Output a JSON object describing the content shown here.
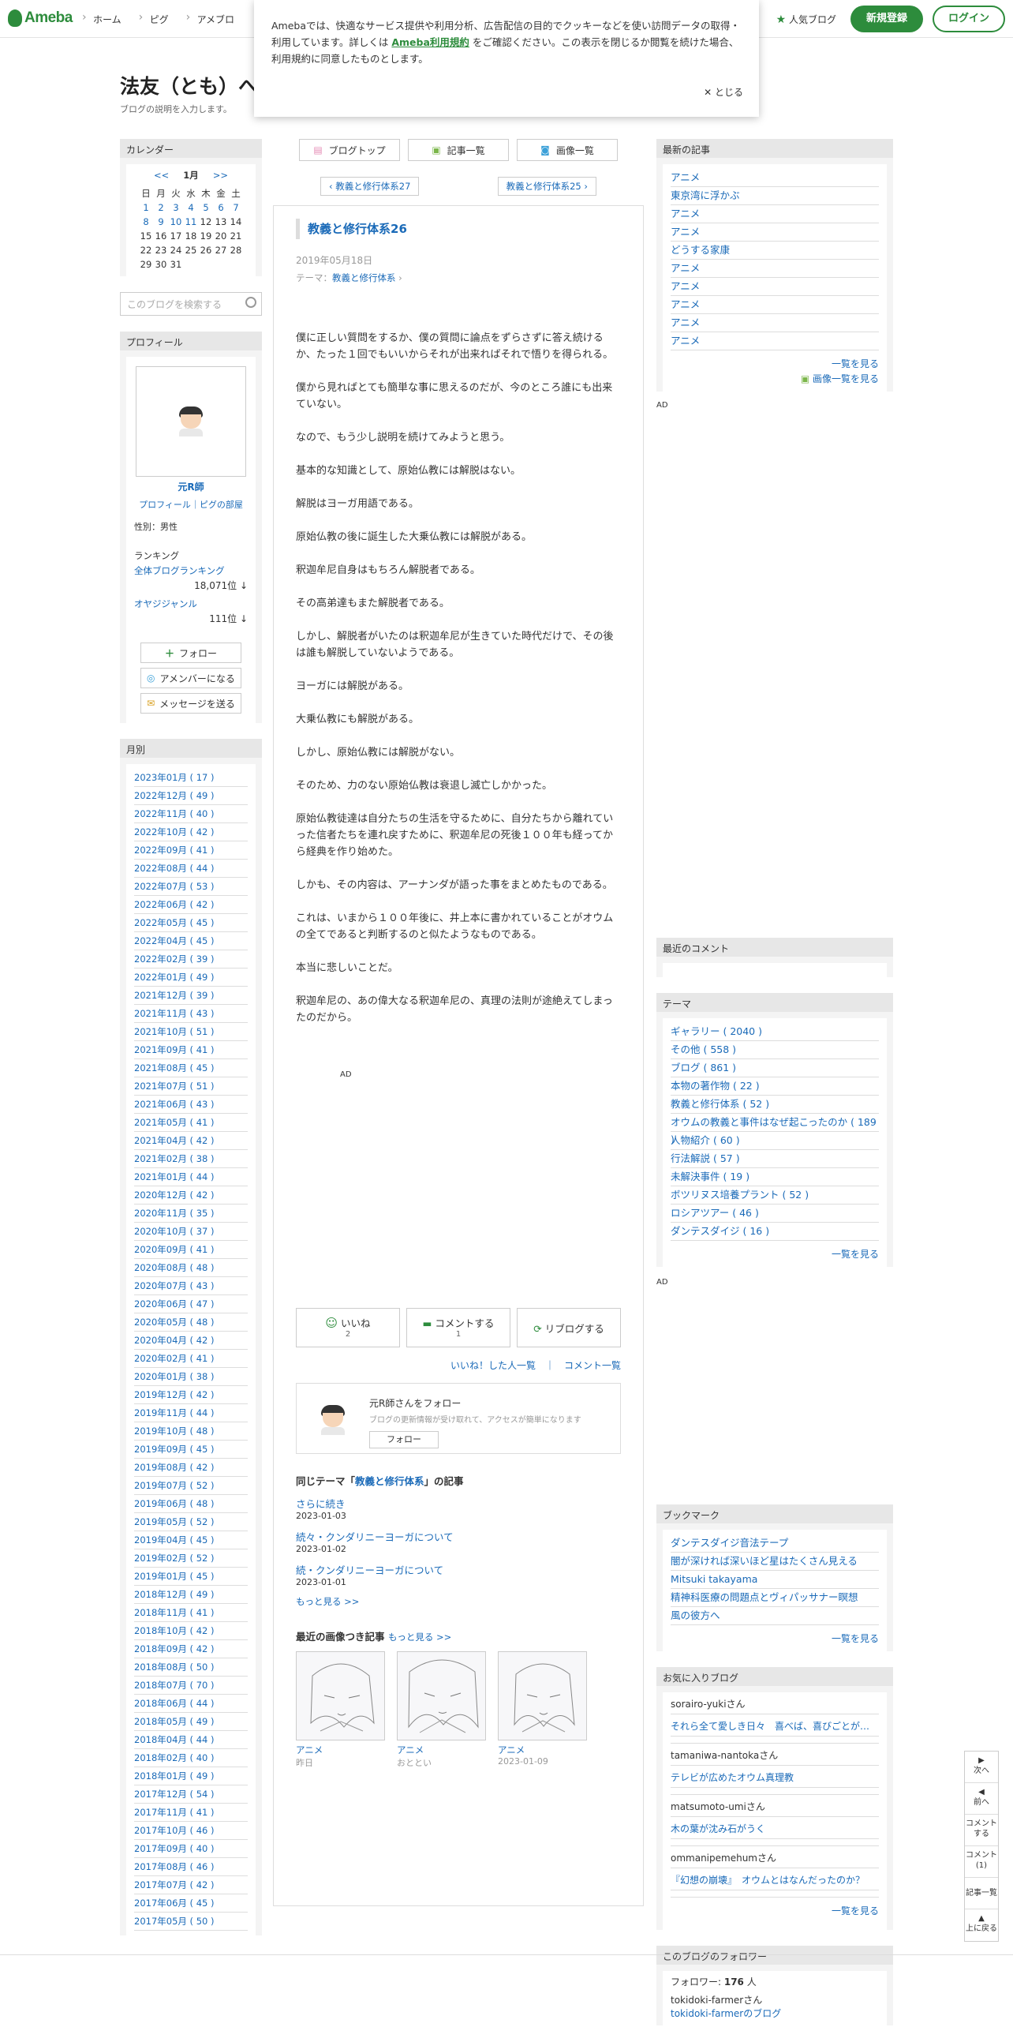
{
  "header": {
    "logo_text": "Ameba",
    "nav": [
      "ホーム",
      "ピグ",
      "アメブロ"
    ],
    "popular_blog": "人気ブログ",
    "register_label": "新規登録",
    "login_label": "ログイン"
  },
  "cookie": {
    "text1": "Amebaでは、快適なサービス提供や利用分析、広告配信の目的でクッキーなどを使い訪問データの取得・利用しています。詳しくは ",
    "link": "Ameba利用規約",
    "text2": " をご確認ください。この表示を閉じるか閲覧を続けた場合、利用規約に同意したものとします。",
    "close": "とじる"
  },
  "blog": {
    "title": "法友（とも）へ",
    "description": "ブログの説明を入力します。"
  },
  "calendar": {
    "heading": "カレンダー",
    "prev": "<<",
    "month": "1月",
    "next": ">>",
    "weekdays": [
      "日",
      "月",
      "火",
      "水",
      "木",
      "金",
      "土"
    ],
    "rows": [
      [
        "",
        "",
        "",
        "",
        "",
        "",
        ""
      ],
      [
        "1",
        "2",
        "3",
        "4",
        "5",
        "6",
        "7"
      ],
      [
        "8",
        "9",
        "10",
        "11",
        "12",
        "13",
        "14"
      ],
      [
        "15",
        "16",
        "17",
        "18",
        "19",
        "20",
        "21"
      ],
      [
        "22",
        "23",
        "24",
        "25",
        "26",
        "27",
        "28"
      ],
      [
        "29",
        "30",
        "31",
        "",
        "",
        "",
        ""
      ]
    ]
  },
  "search": {
    "placeholder": "このブログを検索する"
  },
  "profile": {
    "heading": "プロフィール",
    "name": "元R師",
    "links": "プロフィール｜ピグの部屋",
    "gender": "性別：男性",
    "ranking_label": "ランキング",
    "overall_label": "全体ブログランキング",
    "overall_value": "18,071位 ↓",
    "genre_label": "オヤジジャンル",
    "genre_value": "111位 ↓",
    "follow_btn": "フォロー",
    "member_btn": "アメンバーになる",
    "message_btn": "メッセージを送る"
  },
  "monthly": {
    "heading": "月別",
    "items": [
      "2023年01月 ( 17 )",
      "2022年12月 ( 49 )",
      "2022年11月 ( 40 )",
      "2022年10月 ( 42 )",
      "2022年09月 ( 41 )",
      "2022年08月 ( 44 )",
      "2022年07月 ( 53 )",
      "2022年06月 ( 42 )",
      "2022年05月 ( 45 )",
      "2022年04月 ( 45 )",
      "2022年02月 ( 39 )",
      "2022年01月 ( 49 )",
      "2021年12月 ( 39 )",
      "2021年11月 ( 43 )",
      "2021年10月 ( 51 )",
      "2021年09月 ( 41 )",
      "2021年08月 ( 45 )",
      "2021年07月 ( 51 )",
      "2021年06月 ( 43 )",
      "2021年05月 ( 41 )",
      "2021年04月 ( 42 )",
      "2021年02月 ( 38 )",
      "2021年01月 ( 44 )",
      "2020年12月 ( 42 )",
      "2020年11月 ( 35 )",
      "2020年10月 ( 37 )",
      "2020年09月 ( 41 )",
      "2020年08月 ( 48 )",
      "2020年07月 ( 43 )",
      "2020年06月 ( 47 )",
      "2020年05月 ( 48 )",
      "2020年04月 ( 42 )",
      "2020年02月 ( 41 )",
      "2020年01月 ( 38 )",
      "2019年12月 ( 42 )",
      "2019年11月 ( 44 )",
      "2019年10月 ( 48 )",
      "2019年09月 ( 45 )",
      "2019年08月 ( 42 )",
      "2019年07月 ( 52 )",
      "2019年06月 ( 48 )",
      "2019年05月 ( 52 )",
      "2019年04月 ( 45 )",
      "2019年02月 ( 52 )",
      "2019年01月 ( 45 )",
      "2018年12月 ( 49 )",
      "2018年11月 ( 41 )",
      "2018年10月 ( 42 )",
      "2018年09月 ( 42 )",
      "2018年08月 ( 50 )",
      "2018年07月 ( 70 )",
      "2018年06月 ( 44 )",
      "2018年05月 ( 49 )",
      "2018年04月 ( 44 )",
      "2018年02月 ( 40 )",
      "2018年01月 ( 49 )",
      "2017年12月 ( 54 )",
      "2017年11月 ( 41 )",
      "2017年10月 ( 46 )",
      "2017年09月 ( 40 )",
      "2017年08月 ( 46 )",
      "2017年07月 ( 42 )",
      "2017年06月 ( 45 )",
      "2017年05月 ( 50 )"
    ]
  },
  "topnav": {
    "top": "ブログトップ",
    "list": "記事一覧",
    "images": "画像一覧"
  },
  "pager": {
    "prev": "教義と修行体系27",
    "next": "教義と修行体系25"
  },
  "article": {
    "title": "教義と修行体系26",
    "date": "2019年05月18日",
    "theme_label": "テーマ：",
    "theme": "教義と修行体系",
    "paragraphs": [
      "僕に正しい質問をするか、僕の質問に論点をずらさずに答え続けるか、たった１回でもいいからそれが出来ればそれで悟りを得られる。",
      "僕から見ればとても簡単な事に思えるのだが、今のところ誰にも出来ていない。",
      "なので、もう少し説明を続けてみようと思う。",
      "基本的な知識として、原始仏教には解脱はない。",
      "解脱はヨーガ用語である。",
      "原始仏教の後に誕生した大乗仏教には解脱がある。",
      "釈迦牟尼自身はもちろん解脱者である。",
      "その高弟達もまた解脱者である。",
      "しかし、解脱者がいたのは釈迦牟尼が生きていた時代だけで、その後は誰も解脱していないようである。",
      "ヨーガには解脱がある。",
      "大乗仏教にも解脱がある。",
      "しかし、原始仏教には解脱がない。",
      "そのため、力のない原始仏教は衰退し滅亡しかかった。",
      "原始仏教徒達は自分たちの生活を守るために、自分たちから離れていった信者たちを連れ戻すために、釈迦牟尼の死後１００年も経ってから経典を作り始めた。",
      "しかも、その内容は、アーナンダが語った事をまとめたものである。",
      "これは、いまから１００年後に、井上本に書かれていることがオウムの全てであると判断するのと似たようなものである。",
      "本当に悲しいことだ。",
      "釈迦牟尼の、あの偉大なる釈迦牟尼の、真理の法則が途絶えてしまったのだから。"
    ],
    "ad": "AD",
    "like_label": "いいね",
    "like_count": "2",
    "comment_label": "コメントする",
    "comment_count": "1",
    "reblog_label": "リブログする",
    "liked_users": "いいね！した人一覧",
    "comment_list": "コメント一覧",
    "follow_name": "元R師さんをフォロー",
    "follow_desc": "ブログの更新情報が受け取れて、アクセスが簡単になります",
    "follow_btn": "フォロー",
    "same_theme_pre": "同じテーマ「",
    "same_theme_name": "教義と修行体系",
    "same_theme_post": "」の記事",
    "same_items": [
      {
        "title": "さらに続き",
        "date": "2023-01-03"
      },
      {
        "title": "続々・クンダリニーヨーガについて",
        "date": "2023-01-02"
      },
      {
        "title": "続・クンダリニーヨーガについて",
        "date": "2023-01-01"
      }
    ],
    "more": "もっと見る >>",
    "images_title": "最近の画像つき記事",
    "images_more": "もっと見る >>",
    "thumbs": [
      {
        "caption": "アニメ",
        "date": "昨日"
      },
      {
        "caption": "アニメ",
        "date": "おととい"
      },
      {
        "caption": "アニメ",
        "date": "2023-01-09"
      }
    ]
  },
  "recent": {
    "heading": "最新の記事",
    "items": [
      "アニメ",
      "東京湾に浮かぶ",
      "アニメ",
      "アニメ",
      "どうする家康",
      "アニメ",
      "アニメ",
      "アニメ",
      "アニメ",
      "アニメ"
    ],
    "more": "一覧を見る",
    "images_more": "画像一覧を見る"
  },
  "side_ad": "AD",
  "recent_comments": {
    "heading": "最近のコメント"
  },
  "themes": {
    "heading": "テーマ",
    "items": [
      "ギャラリー ( 2040 )",
      "その他 ( 558 )",
      "ブログ ( 861 )",
      "本物の著作物 ( 22 )",
      "教義と修行体系 ( 52 )",
      "オウムの教義と事件はなぜ起こったのか ( 189 )",
      "人物紹介 ( 60 )",
      "行法解説 ( 57 )",
      "未解決事件 ( 19 )",
      "ボツリヌス培養プラント ( 52 )",
      "ロシアツアー ( 46 )",
      "ダンテスダイジ ( 16 )"
    ],
    "more": "一覧を見る"
  },
  "bookmarks": {
    "heading": "ブックマーク",
    "items": [
      "ダンテスダイジ音法テープ",
      "闇が深ければ深いほど星はたくさん見える",
      "Mitsuki takayama",
      "精神科医療の問題点とヴィパッサナー瞑想",
      "風の彼方へ"
    ],
    "more": "一覧を見る"
  },
  "fav_reblog": {
    "heading": "お気に入りブログ",
    "items": [
      {
        "name": "sorairo-yukiさん",
        "title": "それら全て愛しき日々　喜べば、喜びごとが…"
      },
      {
        "name": "tamaniwa-nantokaさん",
        "title": "テレビが広めたオウム真理教"
      },
      {
        "name": "matsumoto-umiさん",
        "title": "木の葉が沈み石がうく"
      },
      {
        "name": "ommanipemehumさん",
        "title": "『幻想の崩壊』　オウムとはなんだったのか？"
      }
    ],
    "more": "一覧を見る"
  },
  "followers": {
    "heading": "このブログのフォロワー",
    "count_label": "フォロワー: ",
    "count": "176",
    "count_unit": " 人",
    "user": "tokidoki-farmerさん",
    "user_blog": "tokidoki-farmerのブログ"
  },
  "floatnav": {
    "next": "次へ",
    "prev": "前へ",
    "comment": "コメントする",
    "comment_count": "コメント(1)",
    "list": "記事一覧",
    "top": "上に戻る"
  },
  "colors": {
    "brand": "#2d8c3c",
    "link": "#1a6ab8"
  }
}
